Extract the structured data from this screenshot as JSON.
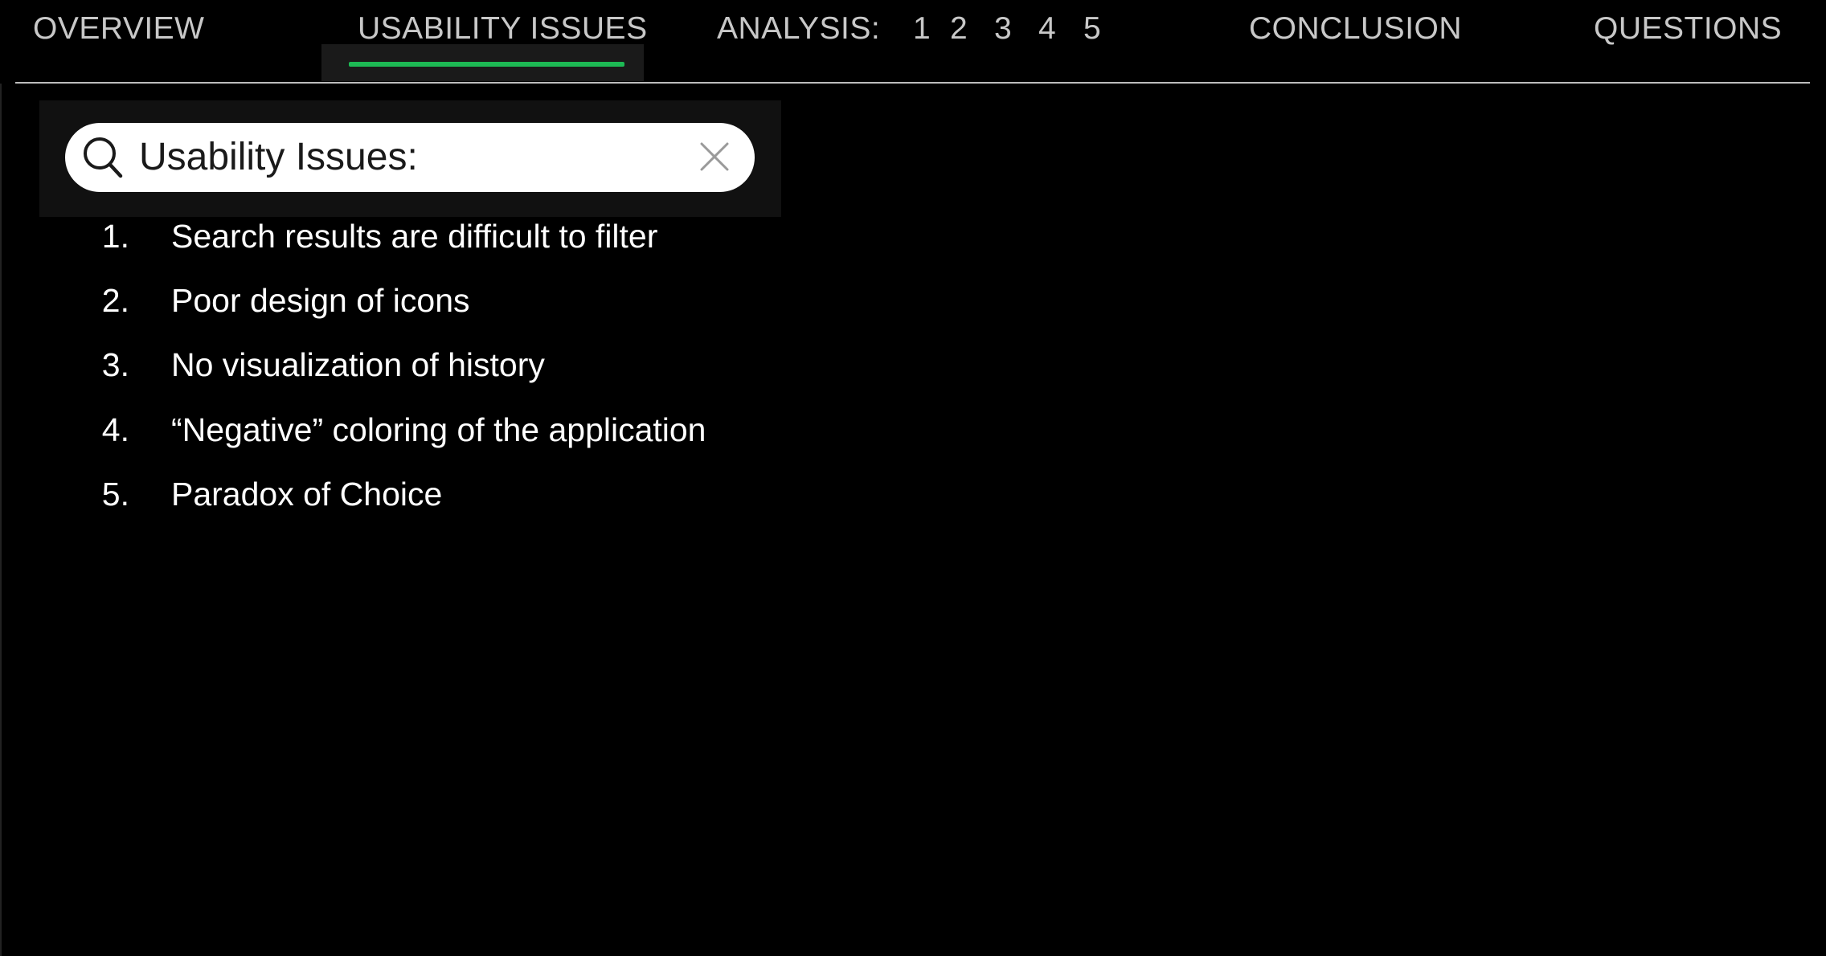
{
  "nav": {
    "overview": "OVERVIEW",
    "usability_issues": "USABILITY ISSUES",
    "analysis_label": "ANALYSIS:",
    "analysis_pages": [
      "1",
      "2",
      "3",
      "4",
      "5"
    ],
    "conclusion": "CONCLUSION",
    "questions": "QUESTIONS",
    "active_tab": "USABILITY ISSUES",
    "accent_color": "#1db954"
  },
  "search": {
    "value": "Usability Issues:",
    "icon": "search-icon",
    "clear_icon": "close-icon"
  },
  "issues": [
    {
      "number": "1.",
      "text": "Search results are difficult to filter"
    },
    {
      "number": "2.",
      "text": "Poor design of icons"
    },
    {
      "number": "3.",
      "text": "No visualization of history"
    },
    {
      "number": "4.",
      "text": "“Negative” coloring of the application"
    },
    {
      "number": "5.",
      "text": "Paradox of Choice"
    }
  ],
  "colors": {
    "background": "#000000",
    "nav_text": "#c8c8c8",
    "accent": "#1db954",
    "search_box": "#ffffff"
  }
}
